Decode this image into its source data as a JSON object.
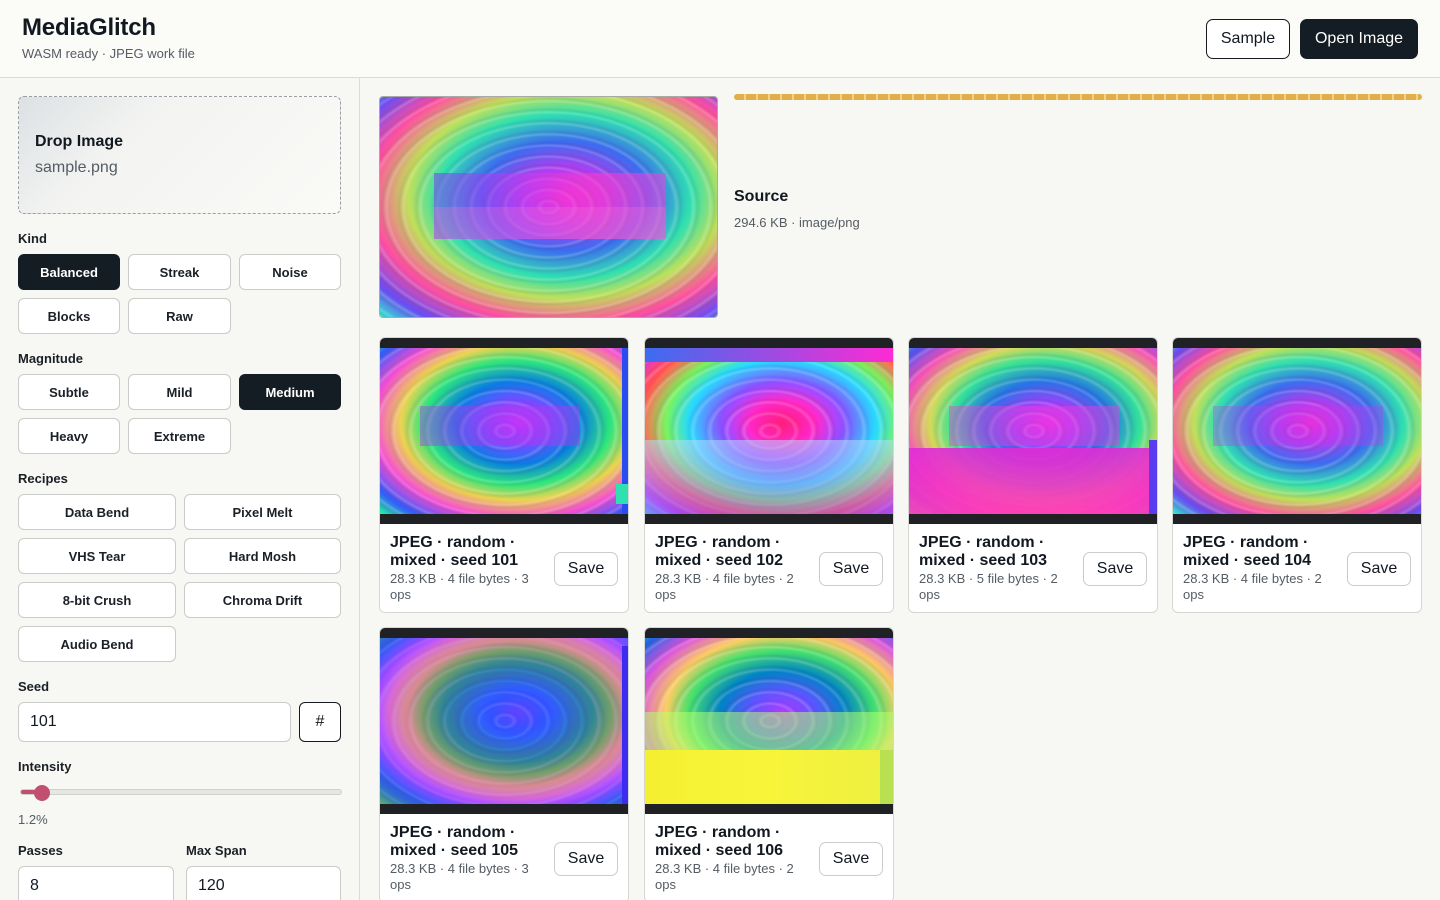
{
  "header": {
    "title": "MediaGlitch",
    "status": "WASM ready · JPEG work file",
    "sample_label": "Sample",
    "open_label": "Open Image"
  },
  "sidebar": {
    "drop": {
      "title": "Drop Image",
      "file": "sample.png"
    },
    "kind": {
      "label": "Kind",
      "options": [
        "Balanced",
        "Streak",
        "Noise",
        "Blocks",
        "Raw"
      ],
      "selected": "Balanced"
    },
    "magnitude": {
      "label": "Magnitude",
      "options": [
        "Subtle",
        "Mild",
        "Medium",
        "Heavy",
        "Extreme"
      ],
      "selected": "Medium"
    },
    "recipes": {
      "label": "Recipes",
      "options": [
        "Data Bend",
        "Pixel Melt",
        "VHS Tear",
        "Hard Mosh",
        "8-bit Crush",
        "Chroma Drift",
        "Audio Bend"
      ]
    },
    "seed": {
      "label": "Seed",
      "value": "101",
      "random_label": "#"
    },
    "intensity": {
      "label": "Intensity",
      "value_text": "1.2%",
      "fraction": 0.065
    },
    "passes": {
      "label": "Passes",
      "value": "8"
    },
    "max_span": {
      "label": "Max Span",
      "value": "120"
    }
  },
  "source": {
    "title": "Source",
    "meta": "294.6 KB · image/png"
  },
  "results": [
    {
      "title": "JPEG · random · mixed · seed 101",
      "meta": "28.3 KB · 4 file bytes · 3 ops",
      "save_label": "Save"
    },
    {
      "title": "JPEG · random · mixed · seed 102",
      "meta": "28.3 KB · 4 file bytes · 2 ops",
      "save_label": "Save"
    },
    {
      "title": "JPEG · random · mixed · seed 103",
      "meta": "28.3 KB · 5 file bytes · 2 ops",
      "save_label": "Save"
    },
    {
      "title": "JPEG · random · mixed · seed 104",
      "meta": "28.3 KB · 4 file bytes · 2 ops",
      "save_label": "Save"
    },
    {
      "title": "JPEG · random · mixed · seed 105",
      "meta": "28.3 KB · 4 file bytes · 3 ops",
      "save_label": "Save"
    },
    {
      "title": "JPEG · random · mixed · seed 106",
      "meta": "28.3 KB · 4 file bytes · 2 ops",
      "save_label": "Save"
    }
  ],
  "colors": {
    "primary": "#141c24",
    "accent": "#c0506e",
    "progress": "#e2ae4a"
  }
}
